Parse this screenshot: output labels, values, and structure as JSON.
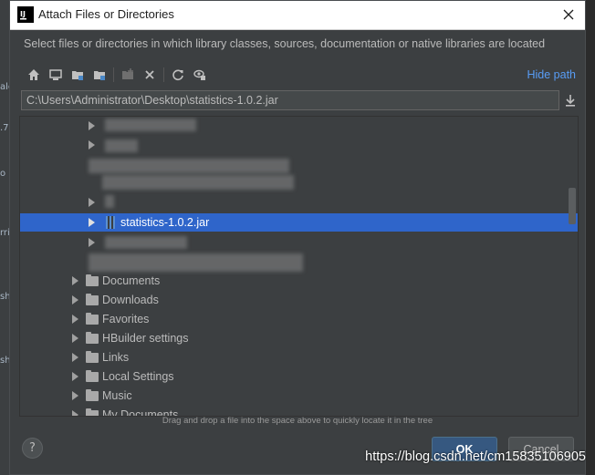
{
  "window": {
    "title": "Attach Files or Directories",
    "description": "Select files or directories in which library classes, sources, documentation or native libraries are located",
    "hide_path_label": "Hide path",
    "path_value": "C:\\Users\\Administrator\\Desktop\\statistics-1.0.2.jar"
  },
  "toolbar": {
    "icons": [
      "home-icon",
      "desktop-icon",
      "project-folder-icon",
      "module-folder-icon",
      "new-folder-icon",
      "delete-icon",
      "refresh-icon",
      "show-hidden-icon"
    ]
  },
  "tree": {
    "selected_item": "statistics-1.0.2.jar",
    "folders": [
      "Documents",
      "Downloads",
      "Favorites",
      "HBuilder settings",
      "Links",
      "Local Settings",
      "Music",
      "My Documents"
    ]
  },
  "hint": "Drag and drop a file into the space above to quickly locate it in the tree",
  "buttons": {
    "help": "?",
    "ok": "OK",
    "cancel": "Cancel"
  },
  "watermark": "https://blog.csdn.net/cm15835106905",
  "colors": {
    "selection": "#2f65ca",
    "link": "#589df6",
    "primary_button": "#365880",
    "background": "#3c3f41"
  }
}
